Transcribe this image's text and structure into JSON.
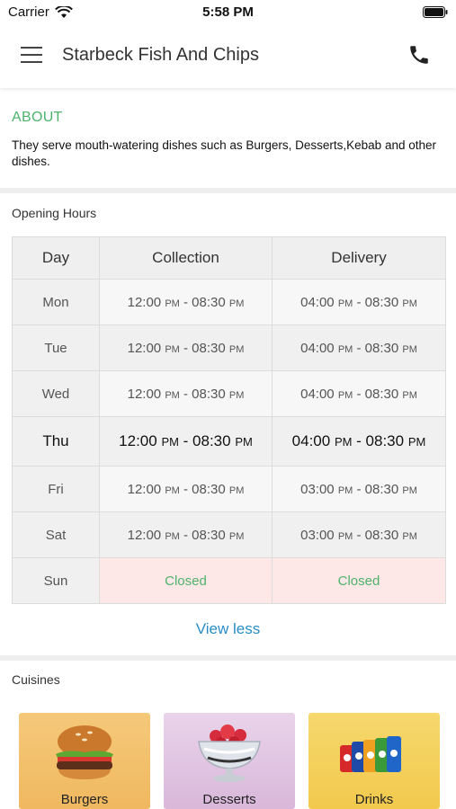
{
  "status_bar": {
    "carrier": "Carrier",
    "time": "5:58 PM"
  },
  "header": {
    "title": "Starbeck Fish And Chips"
  },
  "about": {
    "title": "ABOUT",
    "text": "They serve mouth-watering dishes such as Burgers, Desserts,Kebab and other dishes."
  },
  "opening_hours": {
    "label": "Opening Hours",
    "columns": [
      "Day",
      "Collection",
      "Delivery"
    ],
    "rows": [
      {
        "day": "Mon",
        "collection": {
          "start": "12:00",
          "start_suffix": "PM",
          "end": "08:30",
          "end_suffix": "PM"
        },
        "delivery": {
          "start": "04:00",
          "start_suffix": "PM",
          "end": "08:30",
          "end_suffix": "PM"
        }
      },
      {
        "day": "Tue",
        "collection": {
          "start": "12:00",
          "start_suffix": "PM",
          "end": "08:30",
          "end_suffix": "PM"
        },
        "delivery": {
          "start": "04:00",
          "start_suffix": "PM",
          "end": "08:30",
          "end_suffix": "PM"
        }
      },
      {
        "day": "Wed",
        "collection": {
          "start": "12:00",
          "start_suffix": "PM",
          "end": "08:30",
          "end_suffix": "PM"
        },
        "delivery": {
          "start": "04:00",
          "start_suffix": "PM",
          "end": "08:30",
          "end_suffix": "PM"
        }
      },
      {
        "day": "Thu",
        "collection": {
          "start": "12:00",
          "start_suffix": "PM",
          "end": "08:30",
          "end_suffix": "PM"
        },
        "delivery": {
          "start": "04:00",
          "start_suffix": "PM",
          "end": "08:30",
          "end_suffix": "PM"
        }
      },
      {
        "day": "Fri",
        "collection": {
          "start": "12:00",
          "start_suffix": "PM",
          "end": "08:30",
          "end_suffix": "PM"
        },
        "delivery": {
          "start": "03:00",
          "start_suffix": "PM",
          "end": "08:30",
          "end_suffix": "PM"
        }
      },
      {
        "day": "Sat",
        "collection": {
          "start": "12:00",
          "start_suffix": "PM",
          "end": "08:30",
          "end_suffix": "PM"
        },
        "delivery": {
          "start": "03:00",
          "start_suffix": "PM",
          "end": "08:30",
          "end_suffix": "PM"
        }
      },
      {
        "day": "Sun",
        "collection_closed": "Closed",
        "delivery_closed": "Closed"
      }
    ],
    "view_less": "View less"
  },
  "cuisines": {
    "label": "Cuisines",
    "items": [
      {
        "name": "Burgers",
        "icon": "burger-icon"
      },
      {
        "name": "Desserts",
        "icon": "dessert-icon"
      },
      {
        "name": "Drinks",
        "icon": "drinks-icon"
      }
    ]
  },
  "colors": {
    "accent_green": "#4db36b",
    "link_blue": "#2a8dc4",
    "closed_bg": "#fde7e7"
  }
}
